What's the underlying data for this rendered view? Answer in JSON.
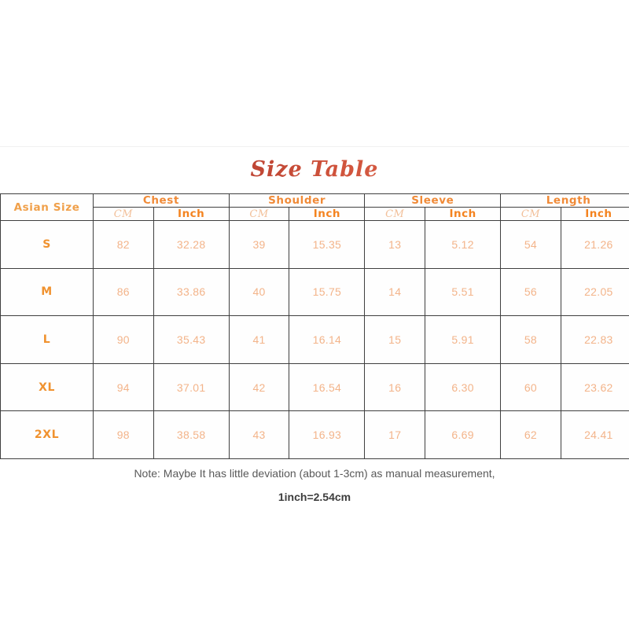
{
  "title": "Size Table",
  "table": {
    "size_column_header": "Asian Size",
    "groups": [
      "Chest",
      "Shoulder",
      "Sleeve",
      "Length"
    ],
    "sub_headers": [
      "CM",
      "Inch"
    ],
    "rows": [
      {
        "size": "S",
        "chest_cm": "82",
        "chest_in": "32.28",
        "shoulder_cm": "39",
        "shoulder_in": "15.35",
        "sleeve_cm": "13",
        "sleeve_in": "5.12",
        "length_cm": "54",
        "length_in": "21.26"
      },
      {
        "size": "M",
        "chest_cm": "86",
        "chest_in": "33.86",
        "shoulder_cm": "40",
        "shoulder_in": "15.75",
        "sleeve_cm": "14",
        "sleeve_in": "5.51",
        "length_cm": "56",
        "length_in": "22.05"
      },
      {
        "size": "L",
        "chest_cm": "90",
        "chest_in": "35.43",
        "shoulder_cm": "41",
        "shoulder_in": "16.14",
        "sleeve_cm": "15",
        "sleeve_in": "5.91",
        "length_cm": "58",
        "length_in": "22.83"
      },
      {
        "size": "XL",
        "chest_cm": "94",
        "chest_in": "37.01",
        "shoulder_cm": "42",
        "shoulder_in": "16.54",
        "sleeve_cm": "16",
        "sleeve_in": "6.30",
        "length_cm": "60",
        "length_in": "23.62"
      },
      {
        "size": "2XL",
        "chest_cm": "98",
        "chest_in": "38.58",
        "shoulder_cm": "43",
        "shoulder_in": "16.93",
        "sleeve_cm": "17",
        "sleeve_in": "6.69",
        "length_cm": "62",
        "length_in": "24.41"
      }
    ]
  },
  "footer": {
    "note": "Note: Maybe It has little deviation (about 1-3cm) as manual measurement,",
    "conversion": "1inch=2.54cm"
  },
  "colors": {
    "title_gradient_start": "#8e2a2a",
    "title_gradient_end": "#e8937c",
    "header_orange": "#f08a37",
    "inch_orange": "#f4831f",
    "cm_peach": "#f2c09a",
    "value_peach": "#f3b48a",
    "size_orange": "#f0922f",
    "border": "#3f3f3f",
    "note_gray": "#595959",
    "background": "#ffffff"
  }
}
